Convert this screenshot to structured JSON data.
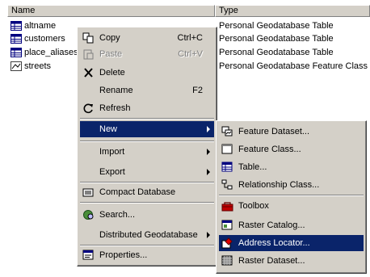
{
  "headers": {
    "name": "Name",
    "type": "Type"
  },
  "items": [
    {
      "name": "altname",
      "type": "Personal Geodatabase Table",
      "icon": "table-icon"
    },
    {
      "name": "customers",
      "type": "Personal Geodatabase Table",
      "icon": "table-icon"
    },
    {
      "name": "place_aliases",
      "type": "Personal Geodatabase Table",
      "icon": "table-icon"
    },
    {
      "name": "streets",
      "type": "Personal Geodatabase Feature Class",
      "icon": "feature-class-icon"
    }
  ],
  "context_menu": {
    "copy": {
      "label": "Copy",
      "shortcut": "Ctrl+C"
    },
    "paste": {
      "label": "Paste",
      "shortcut": "Ctrl+V",
      "enabled": false
    },
    "delete": {
      "label": "Delete"
    },
    "rename": {
      "label": "Rename",
      "shortcut": "F2"
    },
    "refresh": {
      "label": "Refresh"
    },
    "new": {
      "label": "New"
    },
    "import": {
      "label": "Import"
    },
    "export": {
      "label": "Export"
    },
    "compact": {
      "label": "Compact Database"
    },
    "search": {
      "label": "Search..."
    },
    "distributed": {
      "label": "Distributed Geodatabase"
    },
    "properties": {
      "label": "Properties..."
    }
  },
  "new_submenu": {
    "feature_dataset": "Feature Dataset...",
    "feature_class": "Feature Class...",
    "table": "Table...",
    "relationship_class": "Relationship Class...",
    "toolbox": "Toolbox",
    "raster_catalog": "Raster Catalog...",
    "address_locator": "Address Locator...",
    "raster_dataset": "Raster Dataset..."
  },
  "colors": {
    "menu_bg": "#d4d0c8",
    "highlight": "#0a246a"
  }
}
